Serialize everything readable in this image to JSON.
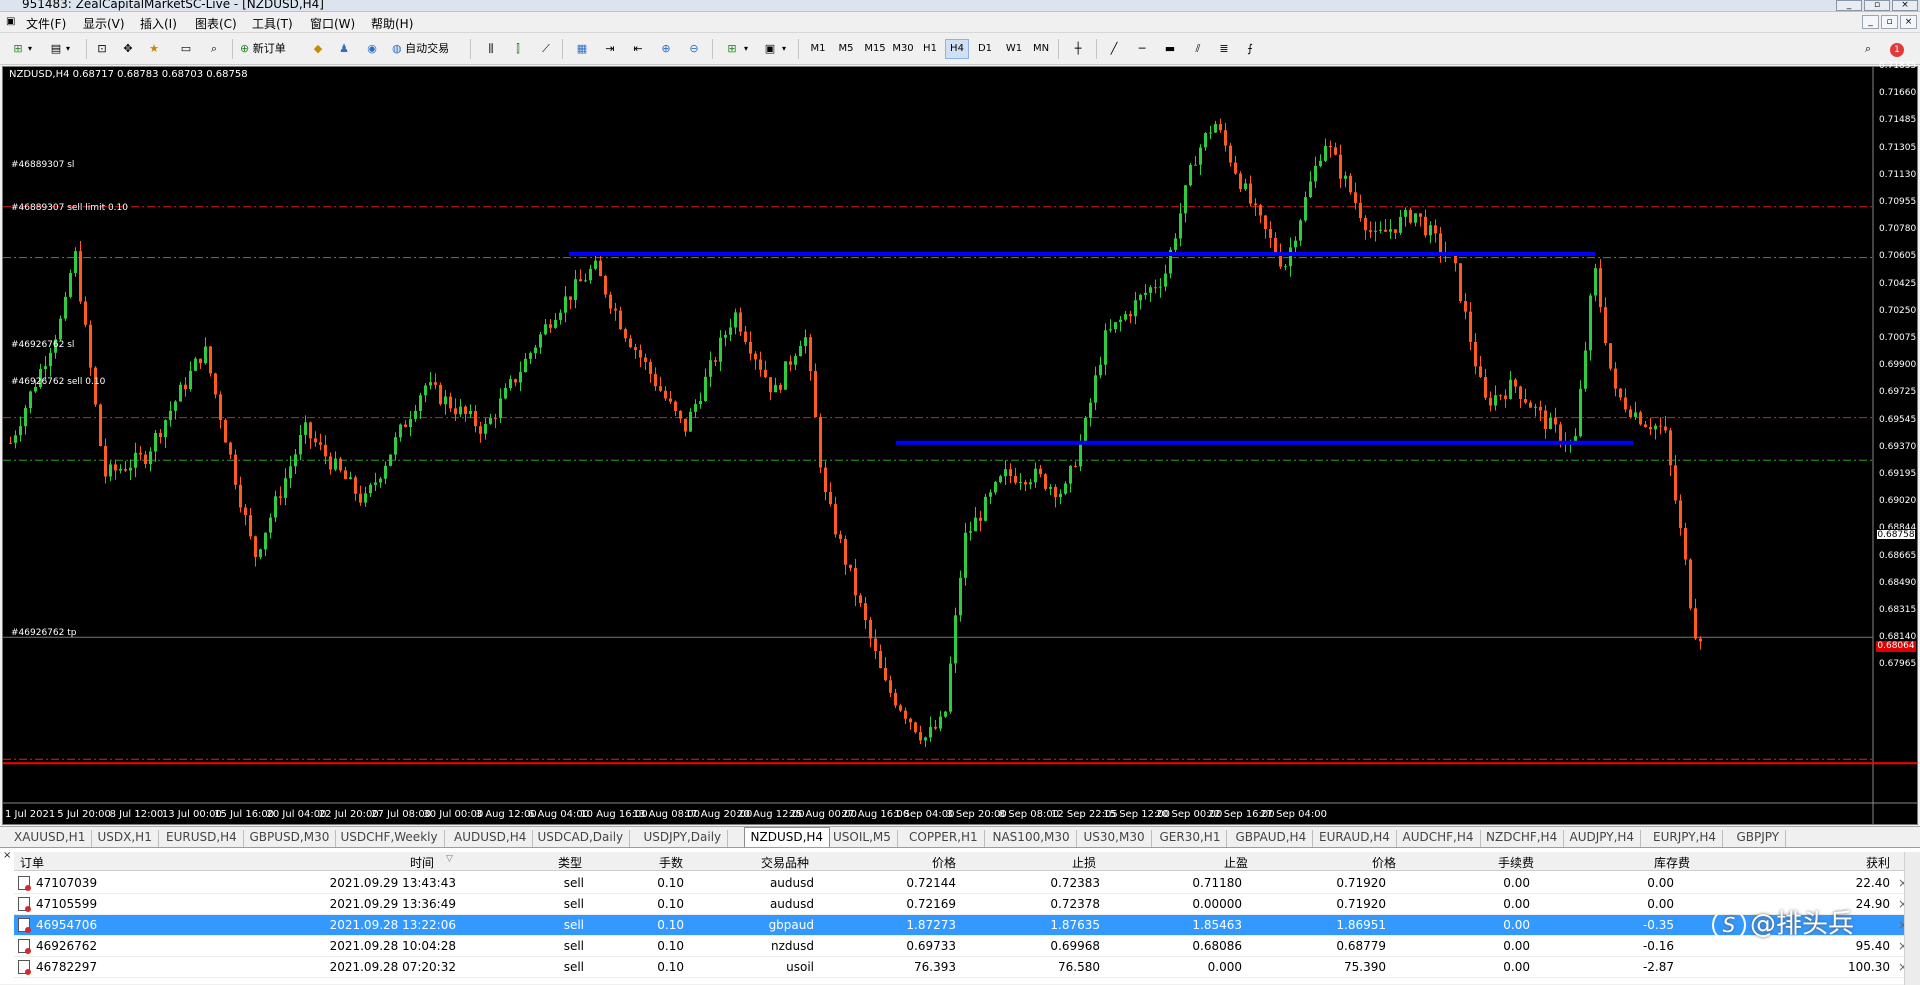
{
  "window": {
    "title": "951483: ZealCapitalMarketSC-Live - [NZDUSD,H4]"
  },
  "menu": [
    "文件(F)",
    "显示(V)",
    "插入(I)",
    "图表(C)",
    "工具(T)",
    "窗口(W)",
    "帮助(H)"
  ],
  "toolbar": {
    "new_order": "新订单",
    "auto_trading": "自动交易",
    "timeframes": [
      "M1",
      "M5",
      "M15",
      "M30",
      "H1",
      "H4",
      "D1",
      "W1",
      "MN"
    ],
    "active_timeframe": "H4",
    "notification_count": "1"
  },
  "chart": {
    "symbol_info": "NZDUSD,H4  0.68717 0.68783 0.68703 0.68758",
    "background": "#000000",
    "bull_color": "#2ecc40",
    "bear_color": "#ff5a1f",
    "price_axis": [
      "0.71835",
      "0.71660",
      "0.71485",
      "0.71305",
      "0.71130",
      "0.70955",
      "0.70780",
      "0.70605",
      "0.70425",
      "0.70250",
      "0.70075",
      "0.69900",
      "0.69725",
      "0.69545",
      "0.69370",
      "0.69195",
      "0.69020",
      "0.68844",
      "0.68665",
      "0.68490",
      "0.68315",
      "0.68140",
      "0.67965"
    ],
    "date_axis": [
      "1 Jul 2021",
      "5 Jul 20:00",
      "8 Jul 12:00",
      "13 Jul 00:00",
      "15 Jul 16:00",
      "20 Jul 04:00",
      "22 Jul 20:00",
      "27 Jul 08:00",
      "30 Jul 00:00",
      "3 Aug 12:00",
      "6 Aug 04:00",
      "10 Aug 16:00",
      "13 Aug 08:00",
      "17 Aug 20:00",
      "20 Aug 12:00",
      "25 Aug 00:00",
      "27 Aug 16:00",
      "1 Sep 04:00",
      "3 Sep 20:00",
      "8 Sep 08:00",
      "12 Sep 22:05",
      "15 Sep 12:00",
      "20 Sep 00:00",
      "22 Sep 16:00",
      "27 Sep 04:00"
    ],
    "current_price": "0.68758",
    "sl_marker_price": "0.68064",
    "order_lines": [
      {
        "label": "#46889307 sl",
        "price": 0.7113,
        "color": "#e02020"
      },
      {
        "label": "#46889307 sell limit 0.10",
        "price": 0.7085,
        "color": "#2fa02f"
      },
      {
        "label": "#46926762 sl",
        "price": 0.69968,
        "color": "#e02020"
      },
      {
        "label": "#46926762 sell 0.10",
        "price": 0.69733,
        "color": "#2fa02f"
      },
      {
        "label": "#46926762 tp",
        "price": 0.68086,
        "color": "#e02020"
      }
    ],
    "trendlines": [
      {
        "from": "3 Aug 12:00",
        "to": "27 Sep 04:00",
        "price": 0.7087,
        "color": "#0000ff"
      },
      {
        "from": "20 Aug 12:00",
        "to": "27 Sep 04:00",
        "price": 0.6983,
        "color": "#0000ff"
      }
    ],
    "bottom_line": {
      "price": 0.68064,
      "color": "#ff0000"
    }
  },
  "symbol_tabs": [
    "XAUUSD,H1",
    "USDX,H1",
    "EURUSD,H4",
    "GBPUSD,M30",
    "USDCHF,Weekly",
    "AUDUSD,H4",
    "USDCAD,Daily",
    "USDJPY,Daily",
    "NZDUSD,H4",
    "USOIL,M5",
    "COPPER,H1",
    "NAS100,M30",
    "US30,M30",
    "GER30,H1",
    "GBPAUD,H4",
    "EURAUD,H4",
    "AUDCHF,H4",
    "NZDCHF,H4",
    "AUDJPY,H4",
    "EURJPY,H4",
    "GBPJPY"
  ],
  "active_tab": "NZDUSD,H4",
  "orders": {
    "columns": [
      "订单",
      "时间",
      "类型",
      "手数",
      "交易品种",
      "价格",
      "止损",
      "止盈",
      "价格",
      "手续费",
      "库存费",
      "获利"
    ],
    "rows": [
      {
        "order": "47107039",
        "time": "2021.09.29 13:43:43",
        "type": "sell",
        "lots": "0.10",
        "symbol": "audusd",
        "open": "0.72144",
        "sl": "0.72383",
        "tp": "0.71180",
        "price": "0.71920",
        "commission": "0.00",
        "swap": "0.00",
        "profit": "22.40",
        "selected": false
      },
      {
        "order": "47105599",
        "time": "2021.09.29 13:36:49",
        "type": "sell",
        "lots": "0.10",
        "symbol": "audusd",
        "open": "0.72169",
        "sl": "0.72378",
        "tp": "0.00000",
        "price": "0.71920",
        "commission": "0.00",
        "swap": "0.00",
        "profit": "24.90",
        "selected": false
      },
      {
        "order": "46954706",
        "time": "2021.09.28 13:22:06",
        "type": "sell",
        "lots": "0.10",
        "symbol": "gbpaud",
        "open": "1.87273",
        "sl": "1.87635",
        "tp": "1.85463",
        "price": "1.86951",
        "commission": "0.00",
        "swap": "-0.35",
        "profit": "",
        "selected": true
      },
      {
        "order": "46926762",
        "time": "2021.09.28 10:04:28",
        "type": "sell",
        "lots": "0.10",
        "symbol": "nzdusd",
        "open": "0.69733",
        "sl": "0.69968",
        "tp": "0.68086",
        "price": "0.68779",
        "commission": "0.00",
        "swap": "-0.16",
        "profit": "95.40",
        "selected": false
      },
      {
        "order": "46782297",
        "time": "2021.09.28 07:20:32",
        "type": "sell",
        "lots": "0.10",
        "symbol": "usoil",
        "open": "76.393",
        "sl": "76.580",
        "tp": "0.000",
        "price": "75.390",
        "commission": "0.00",
        "swap": "-2.87",
        "profit": "100.30",
        "selected": false
      }
    ]
  },
  "watermark": {
    "logo": "S",
    "text": "@排头兵"
  }
}
